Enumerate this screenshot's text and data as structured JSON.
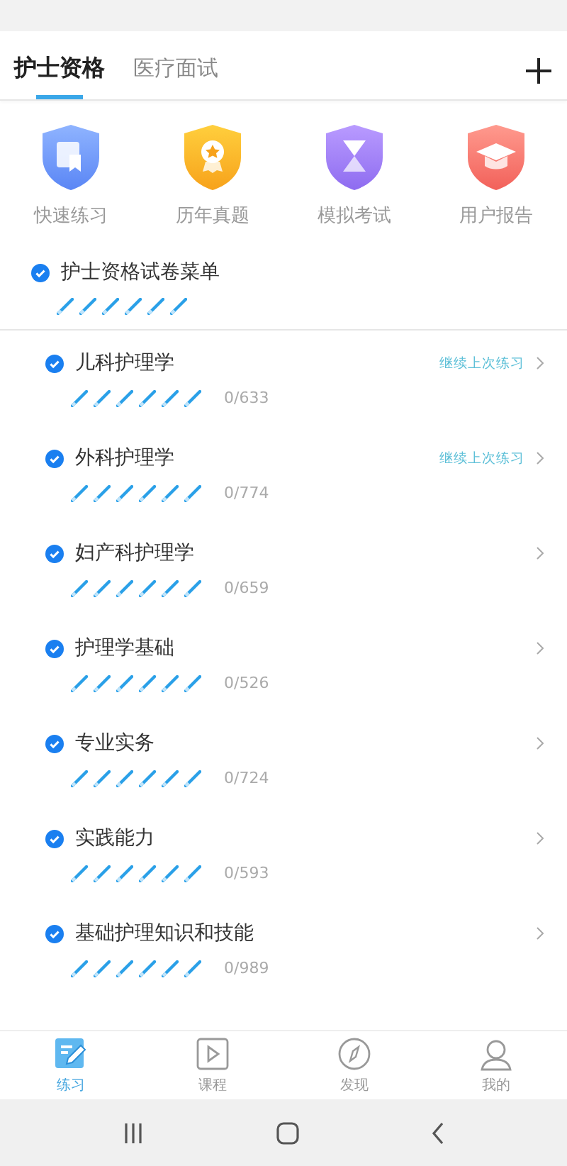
{
  "tabs": [
    {
      "label": "护士资格",
      "selected": true
    },
    {
      "label": "医疗面试",
      "selected": false
    }
  ],
  "quick_actions": [
    {
      "label": "快速练习"
    },
    {
      "label": "历年真题"
    },
    {
      "label": "模拟考试"
    },
    {
      "label": "用户报告"
    }
  ],
  "menu": {
    "title": "护士资格试卷菜单",
    "checked": true
  },
  "subjects": [
    {
      "name": "儿科护理学",
      "checked": true,
      "count": "0/633",
      "link": "继续上次练习"
    },
    {
      "name": "外科护理学",
      "checked": true,
      "count": "0/774",
      "link": "继续上次练习"
    },
    {
      "name": "妇产科护理学",
      "checked": true,
      "count": "0/659"
    },
    {
      "name": "护理学基础",
      "checked": true,
      "count": "0/526"
    },
    {
      "name": "专业实务",
      "checked": true,
      "count": "0/724"
    },
    {
      "name": "实践能力",
      "checked": true,
      "count": "0/593"
    },
    {
      "name": "基础护理知识和技能",
      "checked": true,
      "count": "0/989"
    }
  ],
  "bottom_nav": [
    {
      "label": "练习",
      "selected": true
    },
    {
      "label": "课程",
      "selected": false
    },
    {
      "label": "发现",
      "selected": false
    },
    {
      "label": "我的",
      "selected": false
    }
  ]
}
